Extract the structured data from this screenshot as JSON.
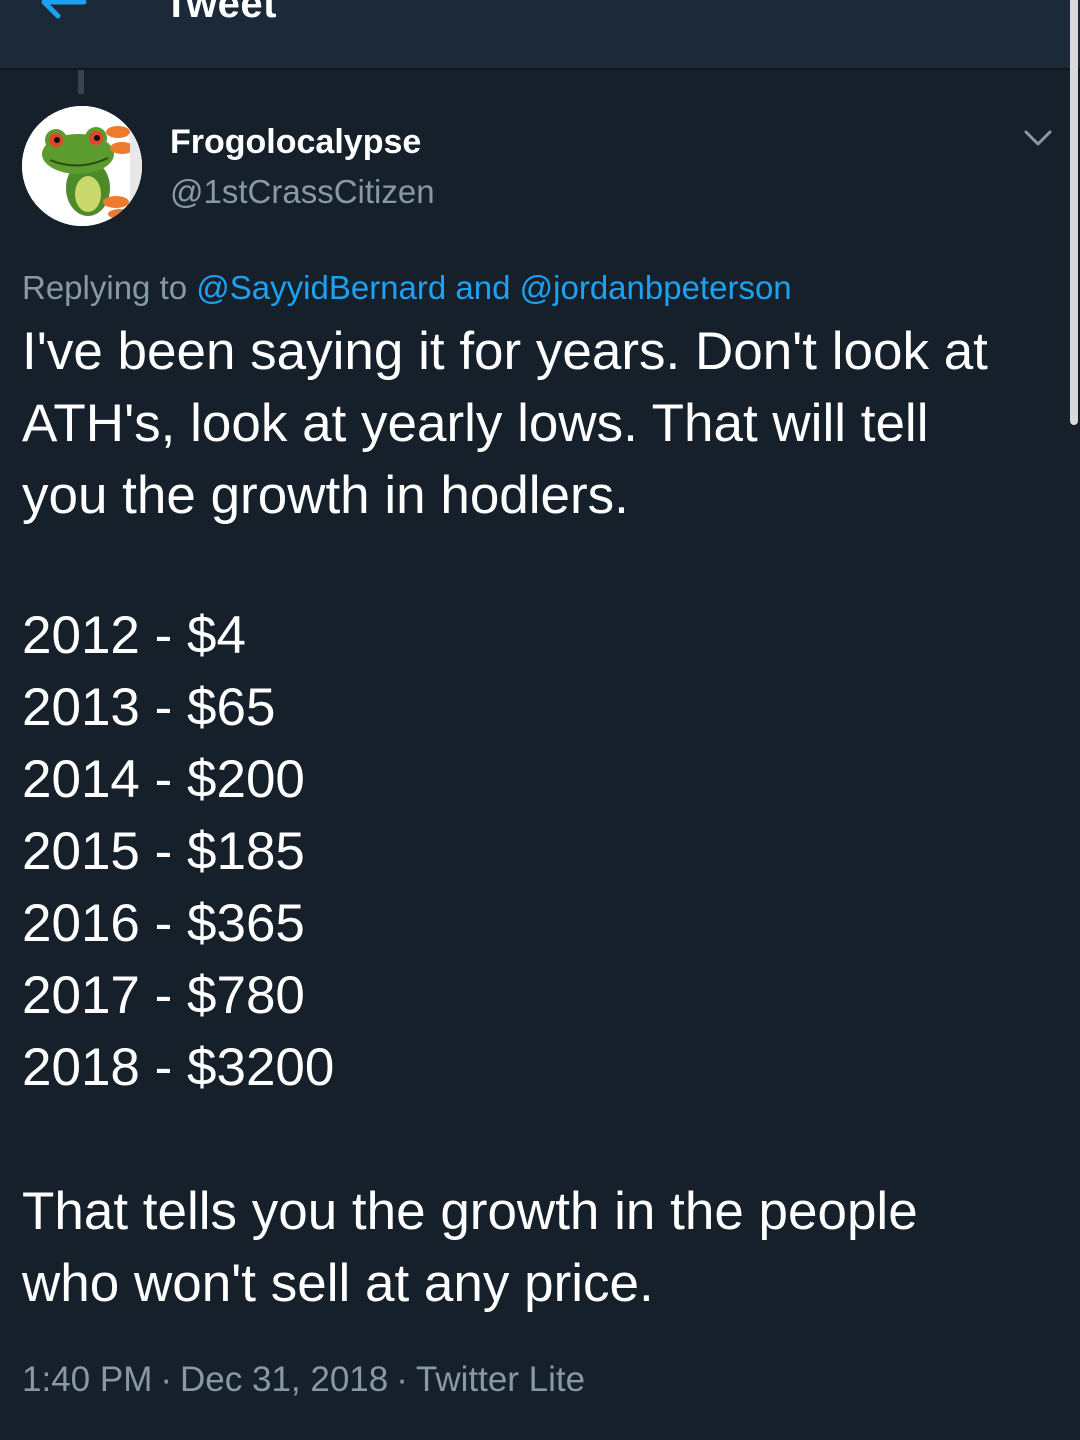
{
  "header": {
    "title": "Tweet"
  },
  "tweet": {
    "display_name": "Frogolocalypse",
    "handle": "@1stCrassCitizen",
    "reply_prefix": "Replying to",
    "reply_mention_1": "@SayyidBernard",
    "reply_and": "and",
    "reply_mention_2": "@jordanbpeterson",
    "text_intro": "I've been saying it for years.  Don't look at\nATH's, look at yearly lows.  That will tell\nyou the growth in hodlers.",
    "yearly_lows": [
      "2012 - $4",
      "2013 - $65",
      "2014 - $200",
      "2015 - $185",
      "2016 - $365",
      "2017 - $780",
      "2018 - $3200"
    ],
    "text_closing": "That tells you the growth in the people\nwho won't sell at any price.",
    "time": "1:40 PM",
    "date": "Dec 31, 2018",
    "source": "Twitter Lite",
    "separator": "·"
  },
  "icons": {
    "back": "back-arrow-icon",
    "caret": "chevron-down-icon",
    "avatar": "frog-avatar"
  },
  "colors": {
    "background": "#15202b",
    "header_background": "#1c2938",
    "accent": "#1da1f2",
    "secondary_text": "#8899a6"
  }
}
